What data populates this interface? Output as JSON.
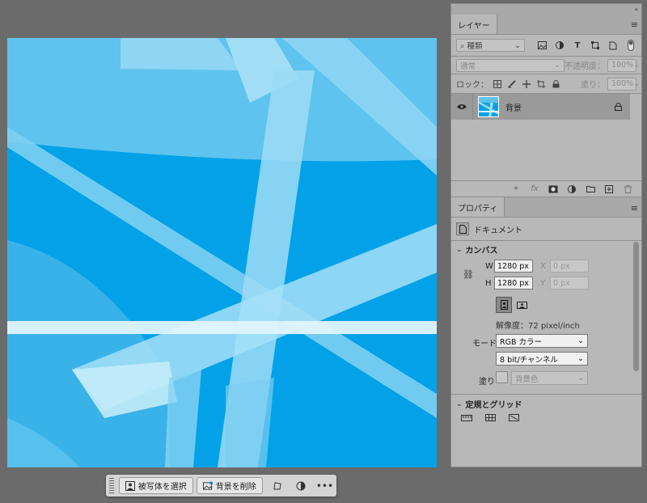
{
  "toolbar": {
    "select_subject": "被写体を選択",
    "remove_bg": "背景を削除",
    "more": "•••"
  },
  "panel_top": {
    "collapse": "«",
    "close": "×"
  },
  "layers": {
    "tab": "レイヤー",
    "menu": "≡",
    "filter_label": "種類",
    "blend_mode": "通常",
    "opacity_label": "不透明度：",
    "opacity_value": "100%",
    "lock_label": "ロック：",
    "fill_label": "塗り：",
    "fill_value": "100%",
    "items": [
      {
        "name": "背景",
        "visible": true,
        "locked": true
      }
    ]
  },
  "properties": {
    "tab": "プロパティ",
    "menu": "≡",
    "doc_label": "ドキュメント",
    "canvas_section": "カンバス",
    "w_label": "W",
    "w_value": "1280 px",
    "h_label": "H",
    "h_value": "1280 px",
    "x_label": "X",
    "x_value": "0 px",
    "y_label": "Y",
    "y_value": "0 px",
    "resolution": "解像度：72 pixel/inch",
    "mode_label": "モード",
    "mode_value": "RGB カラー",
    "depth_value": "8 bit/チャンネル",
    "fill_label": "塗り",
    "fill_value": "背景色",
    "rulers_section": "定規とグリッド"
  },
  "colors": {
    "canvas_blue": "#03a2e8",
    "panel_bg": "#b8b8b8",
    "workspace": "#6b6b6b"
  }
}
